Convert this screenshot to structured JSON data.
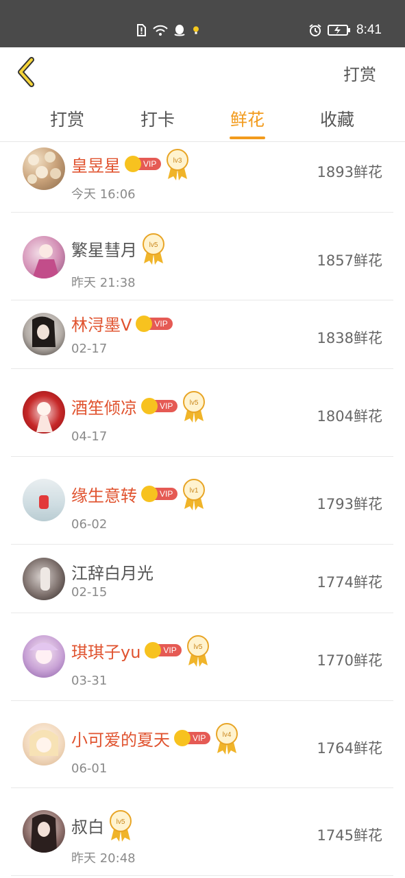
{
  "status_bar": {
    "time": "8:41"
  },
  "header": {
    "right_action": "打赏"
  },
  "tabs": [
    {
      "label": "打赏",
      "active": false
    },
    {
      "label": "打卡",
      "active": false
    },
    {
      "label": "鲜花",
      "active": true
    },
    {
      "label": "收藏",
      "active": false
    }
  ],
  "colors": {
    "accent": "#f29b1d",
    "vip_name": "#e0532f",
    "vip_badge": "#e55a54",
    "crown": "#f7c21f"
  },
  "rows": [
    {
      "name": "皇昱星",
      "vip": true,
      "vip_label": "VIP",
      "level": "lv3",
      "time": "今天 16:06",
      "amount": "1893鲜花"
    },
    {
      "name": "繁星彗月",
      "vip": false,
      "level": "lv5",
      "time": "昨天 21:38",
      "amount": "1857鲜花"
    },
    {
      "name": "林浔墨V",
      "vip": true,
      "vip_label": "VIP",
      "time": "02-17",
      "amount": "1838鲜花"
    },
    {
      "name": "酒笙倾凉",
      "vip": true,
      "vip_label": "VIP",
      "level": "lv5",
      "time": "04-17",
      "amount": "1804鲜花"
    },
    {
      "name": "缘生意转",
      "vip": true,
      "vip_label": "VIP",
      "level": "lv1",
      "time": "06-02",
      "amount": "1793鲜花"
    },
    {
      "name": "江辞白月光",
      "vip": false,
      "time": "02-15",
      "amount": "1774鲜花"
    },
    {
      "name": "琪琪子yu",
      "vip": true,
      "vip_label": "VIP",
      "level": "lv5",
      "time": "03-31",
      "amount": "1770鲜花"
    },
    {
      "name": "小可爱的夏天",
      "vip": true,
      "vip_label": "VIP",
      "level": "lv4",
      "time": "06-01",
      "amount": "1764鲜花"
    },
    {
      "name": "叔白",
      "vip": false,
      "level": "lv5",
      "time": "昨天 20:48",
      "amount": "1745鲜花"
    }
  ]
}
